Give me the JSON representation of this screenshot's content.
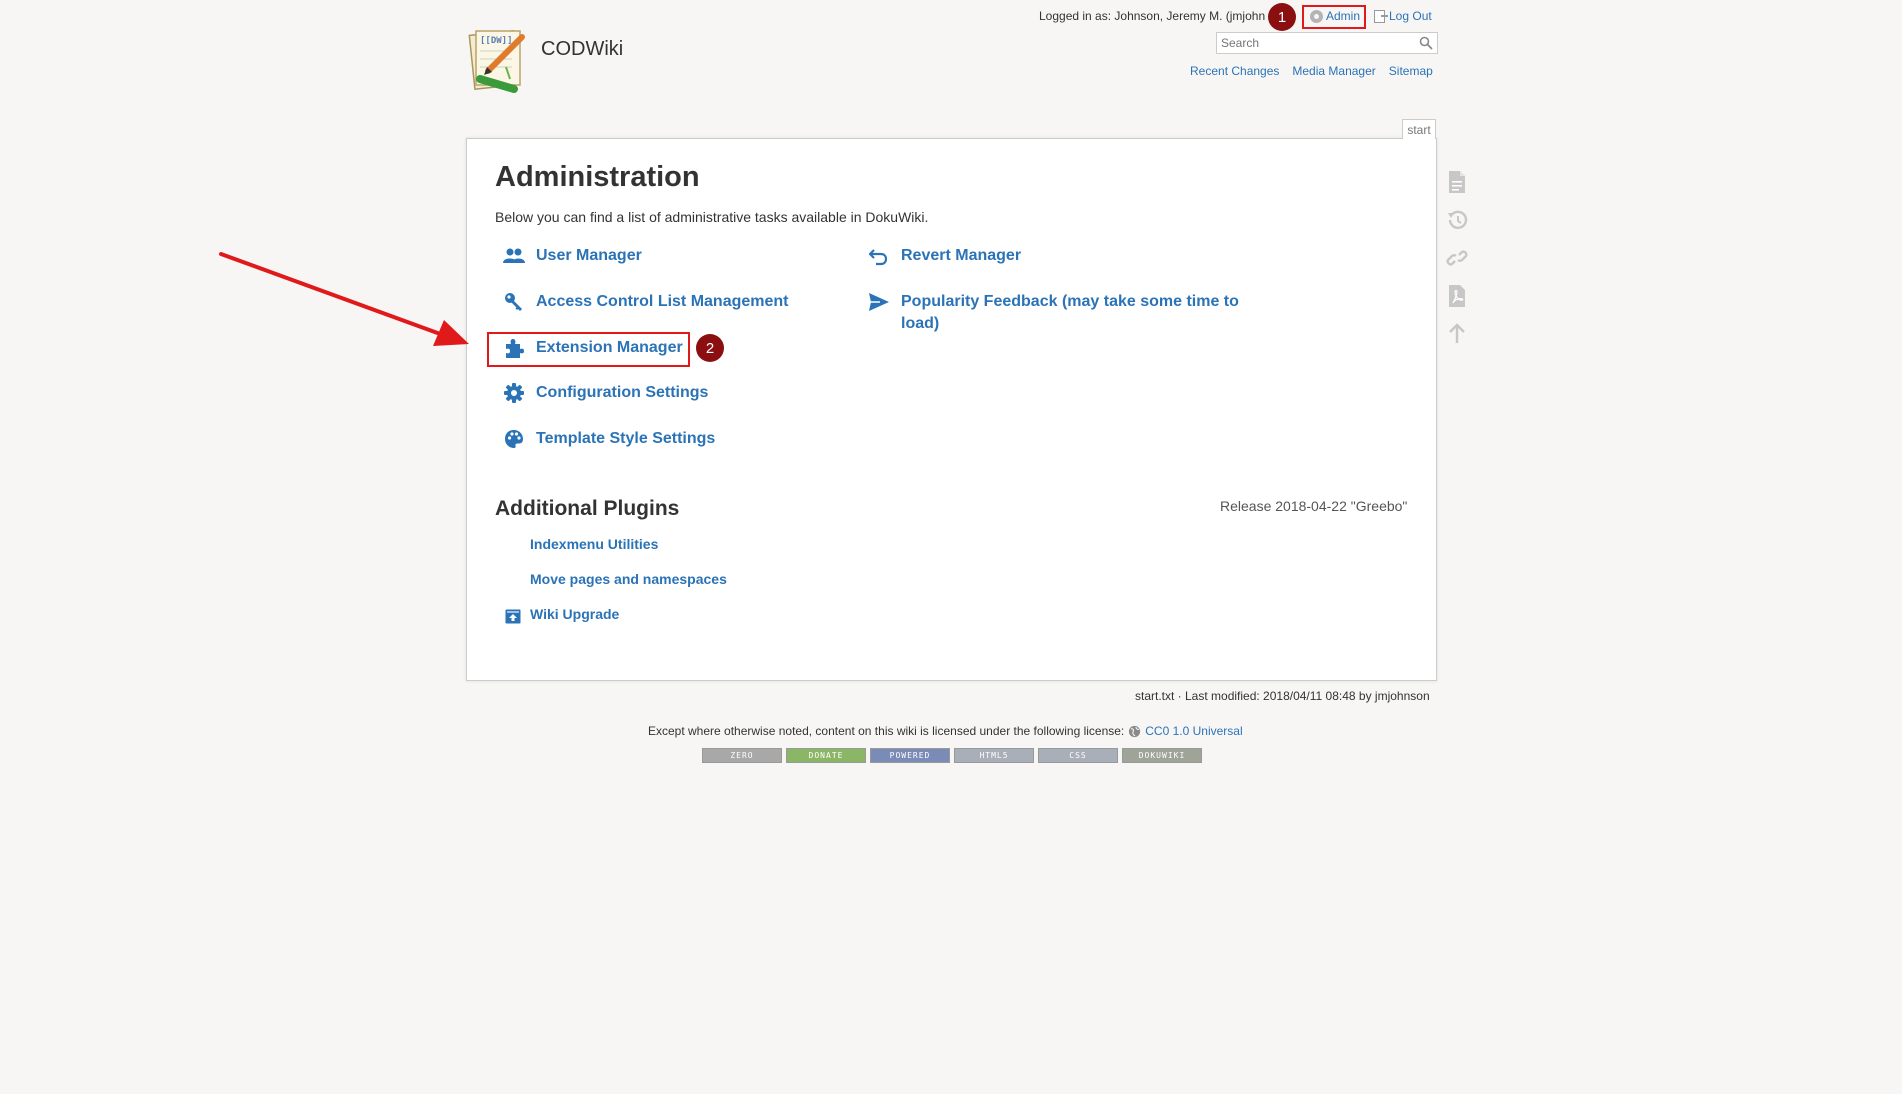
{
  "header": {
    "site_title": "CODWiki",
    "logged_in_text": "Logged in as: Johnson, Jeremy M. (jmjohn",
    "admin_label": "Admin",
    "logout_label": "Log Out",
    "search_placeholder": "Search",
    "nav": [
      "Recent Changes",
      "Media Manager",
      "Sitemap"
    ]
  },
  "page_tab": "start",
  "admin": {
    "title": "Administration",
    "intro": "Below you can find a list of administrative tasks available in DokuWiki.",
    "items_left": [
      {
        "label": "User Manager",
        "icon": "users-icon"
      },
      {
        "label": "Access Control List Management",
        "icon": "key-icon"
      },
      {
        "label": "Extension Manager",
        "icon": "puzzle-icon"
      },
      {
        "label": "Configuration Settings",
        "icon": "gear-icon"
      },
      {
        "label": "Template Style Settings",
        "icon": "palette-icon"
      }
    ],
    "items_right": [
      {
        "label": "Revert Manager",
        "icon": "undo-icon"
      },
      {
        "label": "Popularity Feedback (may take some time to load)",
        "icon": "send-icon"
      }
    ],
    "plugins_title": "Additional Plugins",
    "release": "Release 2018-04-22 \"Greebo\"",
    "plugins": [
      "Indexmenu Utilities",
      "Move pages and namespaces",
      "Wiki Upgrade"
    ]
  },
  "annotations": {
    "badge1": "1",
    "badge2": "2",
    "highlight_color": "#e0191b",
    "badge_color": "#8b0f11"
  },
  "page_tools": [
    "show-page-icon",
    "old-revisions-icon",
    "backlinks-icon",
    "export-pdf-icon",
    "back-to-top-icon"
  ],
  "footer": {
    "docinfo": "start.txt · Last modified: 2018/04/11 08:48 by jmjohnson",
    "license_text": "Except where otherwise noted, content on this wiki is licensed under the following license:",
    "license_link": "CC0 1.0 Universal",
    "badges": [
      "ZERO",
      "DONATE",
      "POWERED",
      "HTML5",
      "CSS",
      "DOKUWIKI"
    ]
  },
  "colors": {
    "link": "#2b73b7",
    "background": "#f7f6f4"
  }
}
